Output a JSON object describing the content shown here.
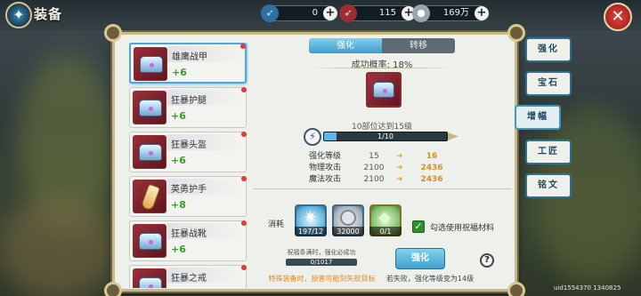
{
  "header": {
    "title": "装备",
    "emblem_icon": "compass-icon"
  },
  "resources": [
    {
      "icon": "feather-blue-icon",
      "value": "0"
    },
    {
      "icon": "feather-red-icon",
      "value": "115"
    },
    {
      "icon": "silver-coin-icon",
      "value": "169万"
    }
  ],
  "equipment_list": [
    {
      "name": "雄鹰战甲",
      "level": "+6",
      "icon": "armor-chest-icon",
      "selected": true
    },
    {
      "name": "狂暴护腿",
      "level": "+6",
      "icon": "armor-chest-icon",
      "selected": false
    },
    {
      "name": "狂暴头盔",
      "level": "+6",
      "icon": "armor-chest-icon",
      "selected": false
    },
    {
      "name": "英勇护手",
      "level": "+8",
      "icon": "bracer-icon",
      "selected": false
    },
    {
      "name": "狂暴战靴",
      "level": "+6",
      "icon": "armor-chest-icon",
      "selected": false
    },
    {
      "name": "狂暴之戒",
      "level": "",
      "icon": "armor-chest-icon",
      "selected": false
    }
  ],
  "tabs": {
    "active": "强化",
    "other": "转移"
  },
  "success_rate": "成功概率: 18%",
  "progress": {
    "note": "10部位达到15级",
    "text": "1/10",
    "fraction": 0.1
  },
  "stats": [
    {
      "label": "强化等级",
      "from": "15",
      "to": "16"
    },
    {
      "label": "物理攻击",
      "from": "2100",
      "to": "2436"
    },
    {
      "label": "魔法攻击",
      "from": "2100",
      "to": "2436"
    }
  ],
  "cost": {
    "label": "消耗",
    "materials": [
      {
        "icon": "blue-crystal-icon",
        "count": "197/12"
      },
      {
        "icon": "silver-coin-icon",
        "count": "32000"
      },
      {
        "icon": "green-gem-icon",
        "count": "0/1"
      }
    ],
    "checkbox_label": "勾选使用祝福材料"
  },
  "blessing": {
    "title": "祝福条满时，强化必成功",
    "value": "0/1017"
  },
  "enhance_button": "强化",
  "warning": "特殊装备时，损害可能到失败目标",
  "fail_note": "若失败，强化等级变为14级",
  "side_menu": [
    {
      "label": "强化",
      "selected": false
    },
    {
      "label": "宝石",
      "selected": false
    },
    {
      "label": "增幅",
      "selected": true
    },
    {
      "label": "工匠",
      "selected": false
    },
    {
      "label": "铭文",
      "selected": false
    }
  ],
  "uid": "uid1554370 1340825",
  "colors": {
    "accent": "#3f9dcc",
    "level_green": "#3a9a2c",
    "upgrade_orange": "#d5902a",
    "frame_gold": "#c8b98a"
  }
}
